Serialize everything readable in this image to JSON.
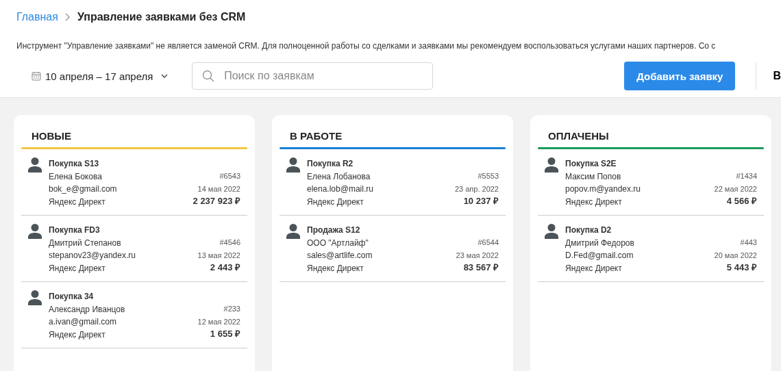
{
  "breadcrumb": {
    "home": "Главная",
    "current": "Управление заявками без CRM"
  },
  "notice": "Инструмент \"Управление заявками\" не является заменой CRM.  Для полноценной работы со сделками и заявками мы рекомендуем воспользоваться услугами наших партнеров.  Со с",
  "toolbar": {
    "date_range": "10 апреля – 17 апреля",
    "search": {
      "placeholder": "Поиск по заявкам"
    },
    "add_button": "Добавить заявку",
    "cut_button": "В"
  },
  "columns": [
    {
      "title": "НОВЫЕ",
      "color": "#f5c542",
      "cards": [
        {
          "title": "Покупка S13",
          "name": "Елена Бокова",
          "email": "bok_e@gmail.com",
          "source": "Яндекс Директ",
          "number": "#6543",
          "date": "14 мая 2022",
          "amount": "2 237 923 ₽"
        },
        {
          "title": "Покупка FD3",
          "name": "Дмитрий Степанов",
          "email": "stepanov23@yandex.ru",
          "source": "Яндекс Директ",
          "number": "#4546",
          "date": "13 мая 2022",
          "amount": "2 443 ₽"
        },
        {
          "title": "Покупка 34",
          "name": "Александр Иванцов",
          "email": "a.ivan@gmail.com",
          "source": "Яндекс Директ",
          "number": "#233",
          "date": "12 мая 2022",
          "amount": "1 655 ₽"
        }
      ]
    },
    {
      "title": "В РАБОТЕ",
      "color": "#1a7fd4",
      "cards": [
        {
          "title": "Покупка R2",
          "name": "Елена Лобанова",
          "email": "elena.lob@mail.ru",
          "source": "Яндекс Директ",
          "number": "#5553",
          "date": "23 апр. 2022",
          "amount": "10 237 ₽"
        },
        {
          "title": "Продажа S12",
          "name": "ООО \"Артлайф\"",
          "email": "sales@artlife.com",
          "source": "Яндекс Директ",
          "number": "#6544",
          "date": "23 мая 2022",
          "amount": "83 567 ₽"
        }
      ]
    },
    {
      "title": "ОПЛАЧЕНЫ",
      "color": "#1a9a5c",
      "cards": [
        {
          "title": "Покупка S2E",
          "name": "Максим Попов",
          "email": "popov.m@yandex.ru",
          "source": "Яндекс Директ",
          "number": "#1434",
          "date": "22 мая 2022",
          "amount": "4 566 ₽"
        },
        {
          "title": "Покупка D2",
          "name": "Дмитрий Федоров",
          "email": "D.Fed@gmail.com",
          "source": "Яндекс Директ",
          "number": "#443",
          "date": "20 мая 2022",
          "amount": "5 443 ₽"
        }
      ]
    }
  ]
}
